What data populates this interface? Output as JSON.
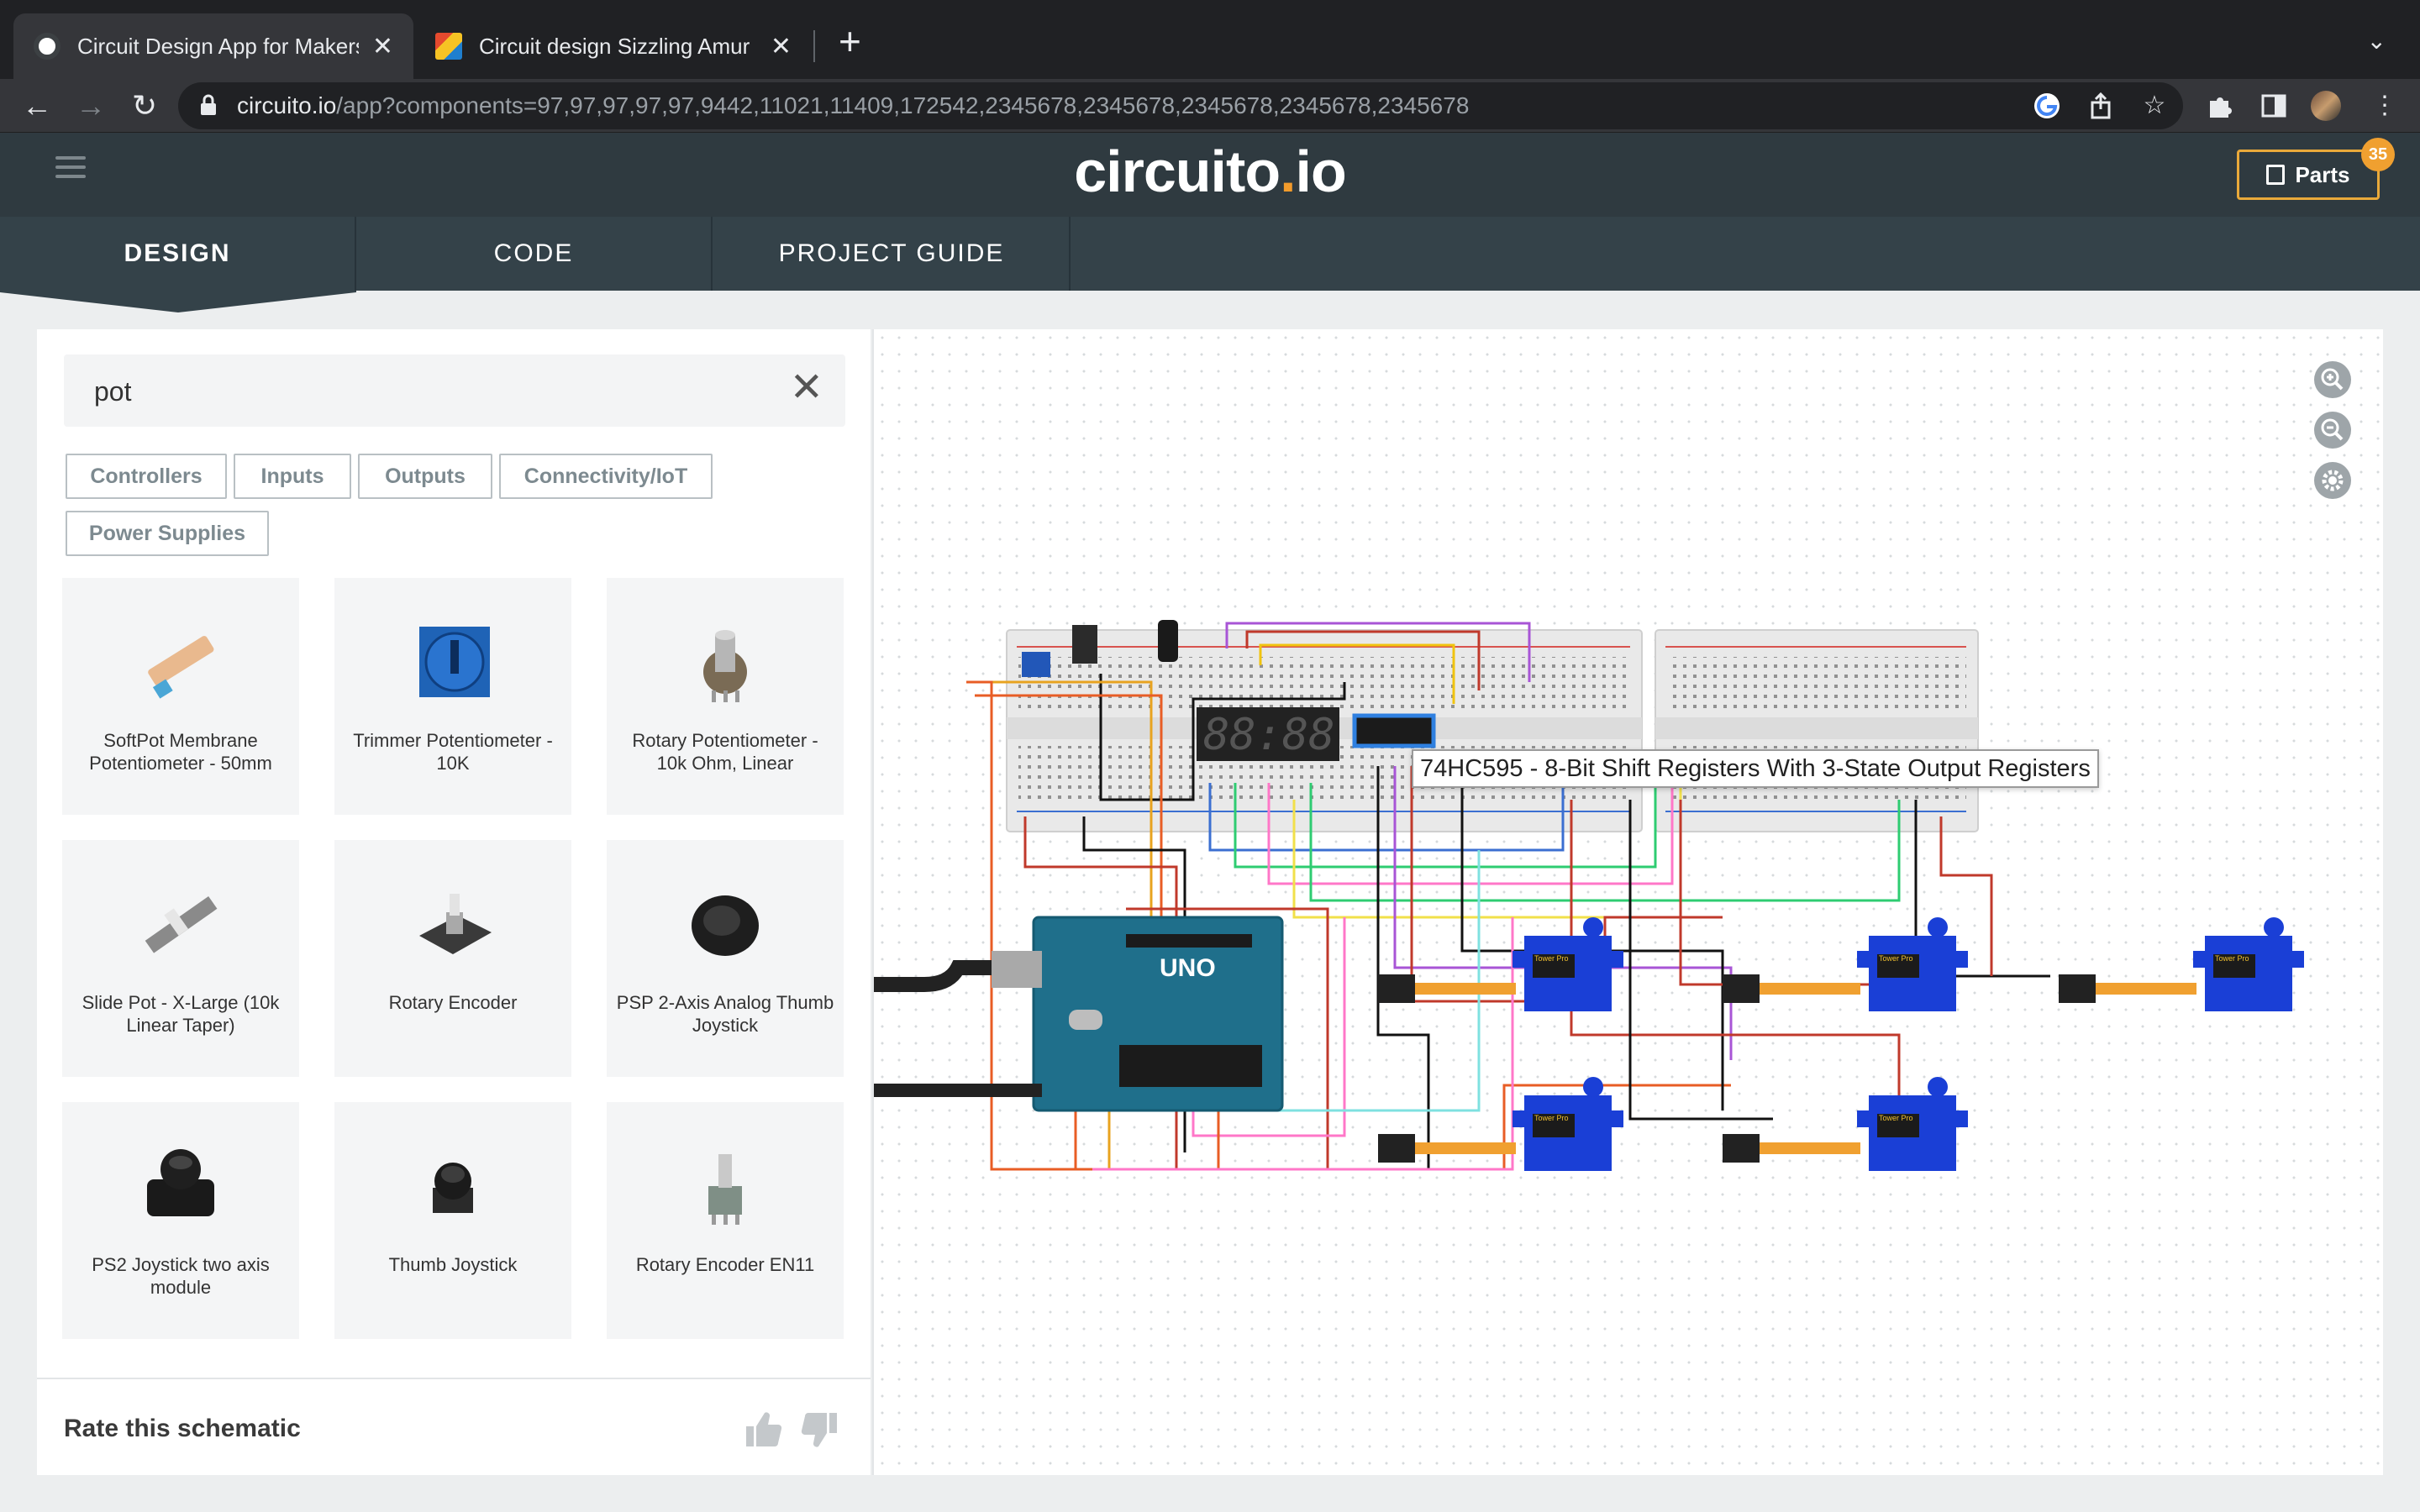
{
  "browser": {
    "tabs": [
      {
        "title": "Circuit Design App for Makers-",
        "active": true
      },
      {
        "title": "Circuit design Sizzling Amur | T",
        "active": false
      }
    ],
    "url_host": "circuito.io",
    "url_path": "/app?components=97,97,97,97,97,9442,11021,11409,172542,2345678,2345678,2345678,2345678,2345678"
  },
  "app": {
    "logo_main": "circuito",
    "logo_dot": ".",
    "logo_end": "io",
    "parts_label": "Parts",
    "parts_count": "35",
    "nav_tabs": [
      {
        "label": "DESIGN",
        "active": true
      },
      {
        "label": "CODE",
        "active": false
      },
      {
        "label": "PROJECT GUIDE",
        "active": false
      }
    ]
  },
  "panel": {
    "search_value": "pot",
    "filters": [
      "Controllers",
      "Inputs",
      "Outputs",
      "Connectivity/IoT",
      "Power Supplies"
    ],
    "components": [
      {
        "label": "SoftPot Membrane Potentiometer - 50mm"
      },
      {
        "label": "Trimmer Potentiometer - 10K"
      },
      {
        "label": "Rotary Potentiometer - 10k Ohm, Linear"
      },
      {
        "label": "Slide Pot - X-Large (10k Linear Taper)"
      },
      {
        "label": "Rotary Encoder"
      },
      {
        "label": "PSP 2-Axis Analog Thumb Joystick"
      },
      {
        "label": "PS2 Joystick two axis module"
      },
      {
        "label": "Thumb Joystick"
      },
      {
        "label": "Rotary Encoder EN11"
      }
    ],
    "rate_label": "Rate this schematic"
  },
  "canvas": {
    "tooltip": "74HC595 - 8-Bit Shift Registers With 3-State Output Registers",
    "display_digits": "88:88",
    "board_label": "UNO",
    "servo_label": "Tower Pro"
  },
  "colors": {
    "header_bg": "#2f3a40",
    "nav_bg": "#344249",
    "accent": "#f0a030",
    "servo_blue": "#1a3fd6"
  }
}
